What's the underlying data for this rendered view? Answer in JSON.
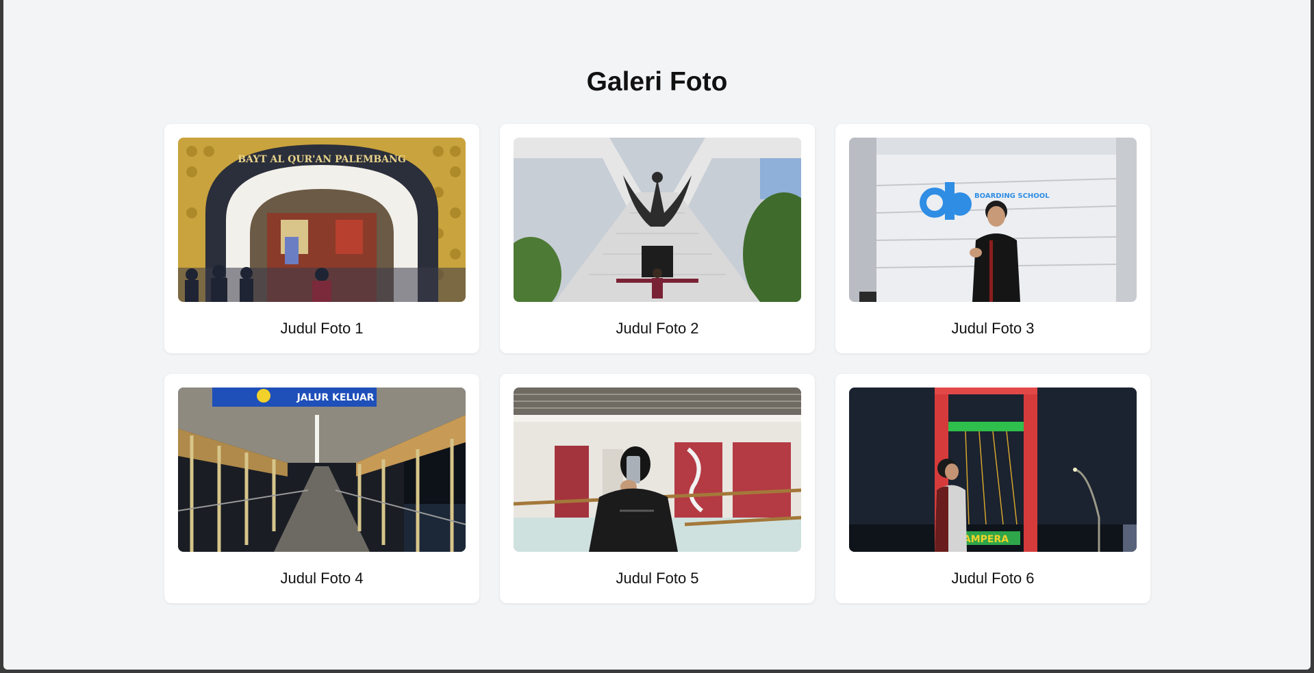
{
  "page": {
    "title": "Galeri Foto",
    "background": "#f3f4f6"
  },
  "gallery": {
    "items": [
      {
        "caption": "Judul Foto 1",
        "photo_text": "BAYT AL QUR'AN PALEMBANG"
      },
      {
        "caption": "Judul Foto 2"
      },
      {
        "caption": "Judul Foto 3",
        "photo_text": "BOARDING SCHOOL"
      },
      {
        "caption": "Judul Foto 4",
        "photo_text": "JALUR KELUAR"
      },
      {
        "caption": "Judul Foto 5"
      },
      {
        "caption": "Judul Foto 6",
        "photo_text": "AMPERA"
      }
    ]
  }
}
